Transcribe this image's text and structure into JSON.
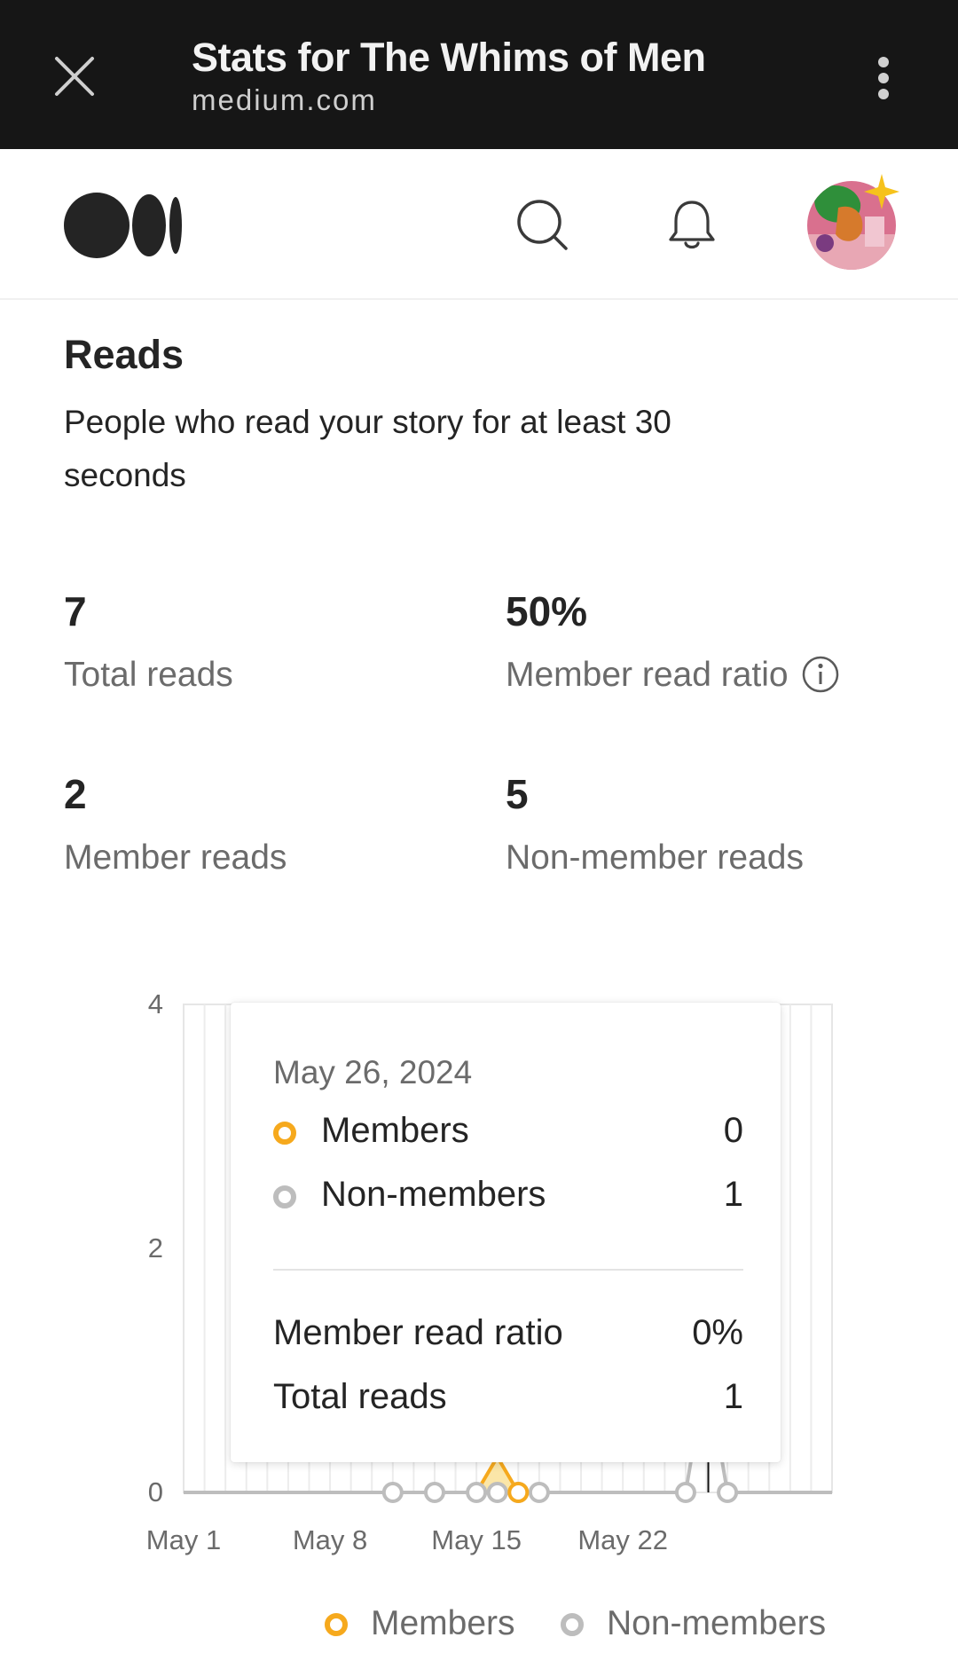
{
  "topbar": {
    "title": "Stats for The Whims of Men",
    "url": "medium.com"
  },
  "header": {
    "icons": [
      "medium-logo",
      "search-icon",
      "bell-icon",
      "avatar"
    ]
  },
  "reads": {
    "title": "Reads",
    "subtitle": "People who read your story for at least 30 seconds",
    "stats": [
      {
        "value": "7",
        "label": "Total reads"
      },
      {
        "value": "50%",
        "label": "Member read ratio"
      },
      {
        "value": "2",
        "label": "Member reads"
      },
      {
        "value": "5",
        "label": "Non-member reads"
      }
    ]
  },
  "chart_data": {
    "type": "line",
    "ylim": [
      0,
      4
    ],
    "yticks": [
      "0",
      "2",
      "4"
    ],
    "xticks": [
      "May 1",
      "May 8",
      "May 15",
      "May 22"
    ],
    "grid": true,
    "legend_position": "bottom",
    "series": [
      {
        "name": "Members",
        "color": "#f6a91d",
        "points": [
          [
            11,
            0
          ],
          [
            13,
            0
          ],
          [
            14,
            0
          ],
          [
            15,
            0
          ],
          [
            16,
            0
          ],
          [
            17,
            0
          ],
          [
            18,
            0
          ],
          [
            25,
            0
          ],
          [
            26,
            0
          ],
          [
            27,
            0
          ]
        ]
      },
      {
        "name": "Non-members",
        "color": "#bdbdbd",
        "points": [
          [
            11,
            0
          ],
          [
            13,
            0
          ],
          [
            15,
            0
          ],
          [
            16,
            0
          ],
          [
            17,
            0
          ],
          [
            18,
            0
          ],
          [
            25,
            0
          ],
          [
            26,
            1
          ],
          [
            27,
            0
          ]
        ]
      }
    ],
    "highlight": {
      "date": "May 26, 2024",
      "x": 26,
      "y": 1
    }
  },
  "tooltip": {
    "date": "May 26, 2024",
    "rows": [
      {
        "name": "Members",
        "value": "0"
      },
      {
        "name": "Non-members",
        "value": "1"
      }
    ],
    "summary": [
      {
        "name": "Member read ratio",
        "value": "0%"
      },
      {
        "name": "Total reads",
        "value": "1"
      }
    ]
  },
  "legend": {
    "members": "Members",
    "nonmembers": "Non-members"
  },
  "colors": {
    "members": "#f6a91d",
    "nonmembers": "#bdbdbd",
    "topbar": "#161616"
  }
}
